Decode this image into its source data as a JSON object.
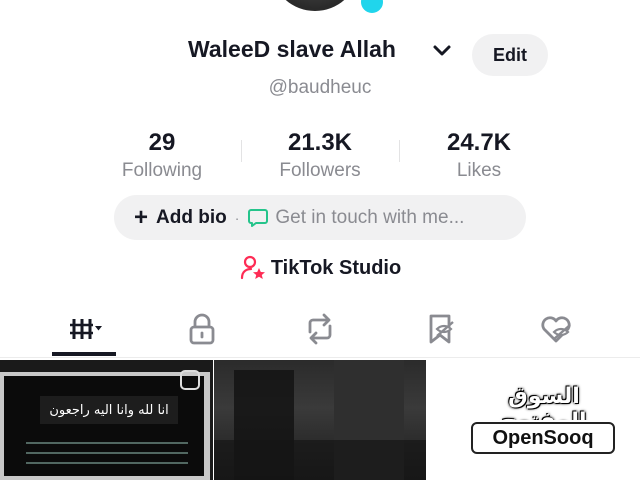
{
  "profile": {
    "name": "WaleeD slave Allah",
    "handle": "@baudheuc",
    "edit_label": "Edit"
  },
  "stats": [
    {
      "value": "29",
      "label": "Following"
    },
    {
      "value": "21.3K",
      "label": "Followers"
    },
    {
      "value": "24.7K",
      "label": "Likes"
    }
  ],
  "bio": {
    "add_label": "Add bio",
    "separator": "·",
    "contact_placeholder": "Get in touch with me..."
  },
  "studio": {
    "label": "TikTok Studio"
  },
  "tabs": [
    {
      "icon": "videos-grid-icon",
      "selected": true
    },
    {
      "icon": "lock-icon",
      "selected": false
    },
    {
      "icon": "repost-icon",
      "selected": false
    },
    {
      "icon": "favorites-bookmark-icon",
      "selected": false
    },
    {
      "icon": "liked-heart-icon",
      "selected": false
    }
  ],
  "videos": [
    {
      "overlay_text": "انا لله وانا اليه راجعون"
    },
    {},
    {
      "watermark_ar": "السوق المفتوح",
      "watermark_en": "OpenSooq"
    }
  ],
  "colors": {
    "accent_blue": "#20d5ec",
    "studio_pink": "#fe2c55",
    "chat_green": "#25c48b",
    "text_primary": "#161823",
    "text_secondary": "#8a8b91",
    "pill_bg": "#f1f1f2"
  }
}
